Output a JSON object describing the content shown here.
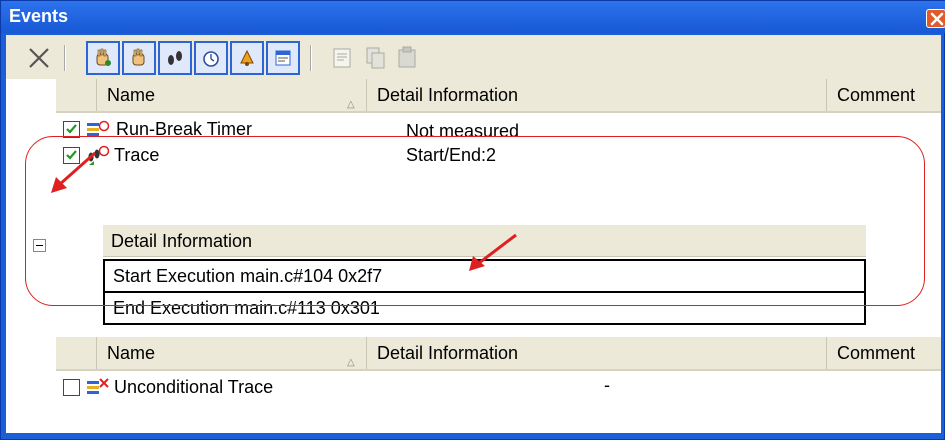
{
  "window": {
    "title": "Events"
  },
  "toolbar": {
    "buttons": [
      {
        "icon": "delete-icon",
        "enabled": true
      },
      {
        "icon": "hardware-break-icon",
        "enabled": true
      },
      {
        "icon": "software-break-icon",
        "enabled": true
      },
      {
        "icon": "trace-icon",
        "enabled": true
      },
      {
        "icon": "timer-icon",
        "enabled": true
      },
      {
        "icon": "alarm-icon",
        "enabled": true
      },
      {
        "icon": "event-list-icon",
        "enabled": true
      },
      {
        "icon": "edit-icon",
        "enabled": false
      },
      {
        "icon": "copy-icon",
        "enabled": false
      },
      {
        "icon": "paste-icon",
        "enabled": false
      }
    ]
  },
  "columns": {
    "name": "Name",
    "detail": "Detail Information",
    "comment": "Comment"
  },
  "events": [
    {
      "name": "Run-Break Timer",
      "detail": "Not measured",
      "checked": true,
      "icon": "run-break-timer-icon"
    },
    {
      "name": "Trace",
      "detail": "Start/End:2",
      "checked": true,
      "icon": "trace-event-icon",
      "expanded": true
    }
  ],
  "trace_detail": {
    "header": "Detail Information",
    "rows": [
      "Start Execution main.c#104 0x2f7",
      "End Execution main.c#113 0x301"
    ]
  },
  "second_group": {
    "columns": {
      "name": "Name",
      "detail": "Detail Information",
      "comment": "Comment"
    },
    "events": [
      {
        "name": "Unconditional Trace",
        "detail": "-",
        "checked": false,
        "icon": "unconditional-trace-icon"
      }
    ]
  },
  "colors": {
    "accent": "#1a5ed8",
    "annotation": "#e02020",
    "check": "#1f9a1f"
  }
}
